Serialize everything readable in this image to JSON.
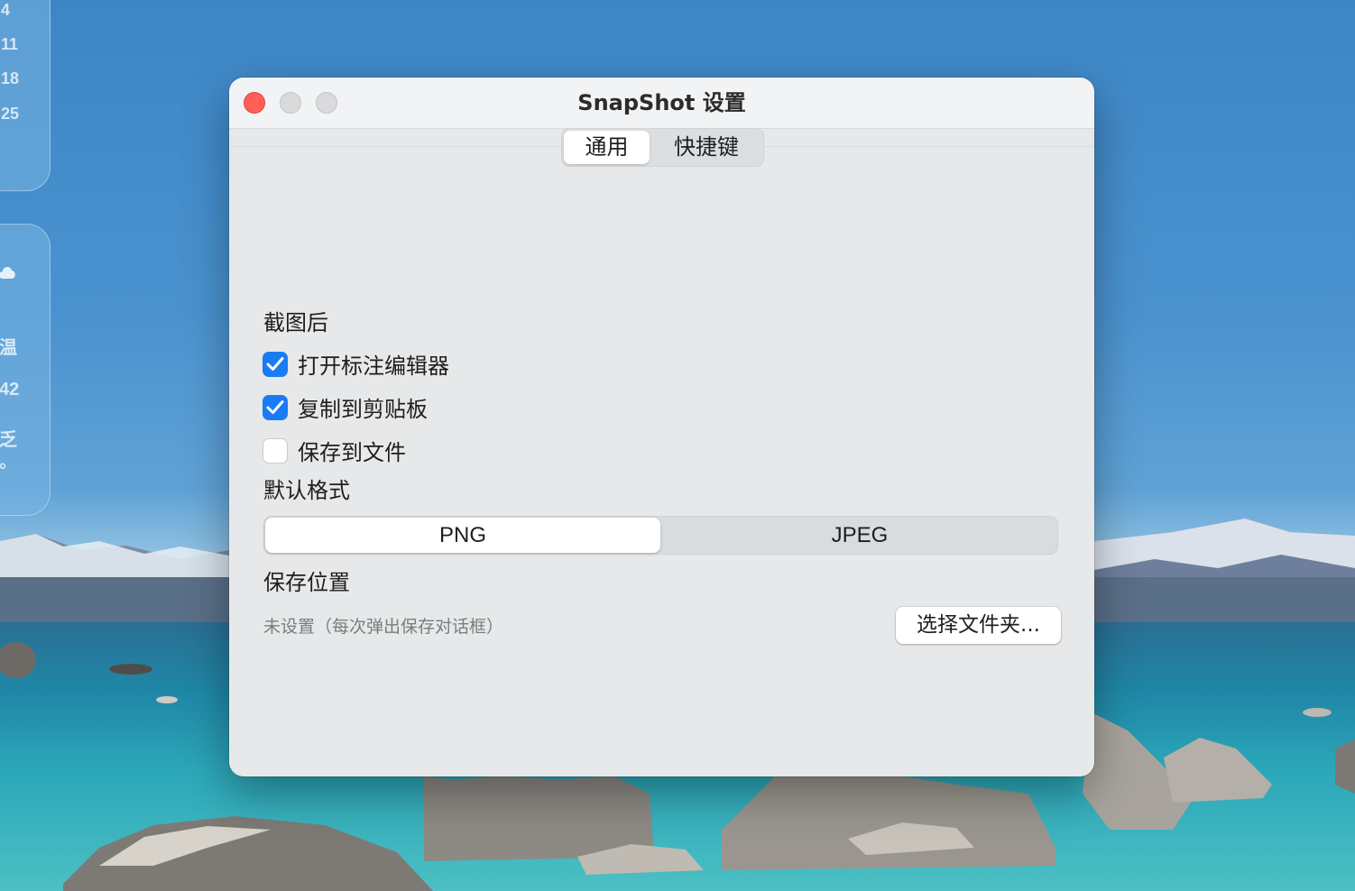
{
  "desktop": {
    "calendar_widget": {
      "dates": [
        "4",
        "11",
        "18",
        "25"
      ]
    },
    "weather_widget": {
      "lines": [
        "温",
        "42",
        "乏",
        "°"
      ]
    }
  },
  "window": {
    "title": "SnapShot 设置",
    "tabs": [
      {
        "label": "通用",
        "selected": true
      },
      {
        "label": "快捷键",
        "selected": false
      }
    ],
    "after_capture": {
      "heading": "截图后",
      "options": [
        {
          "label": "打开标注编辑器",
          "checked": true
        },
        {
          "label": "复制到剪贴板",
          "checked": true
        },
        {
          "label": "保存到文件",
          "checked": false
        }
      ]
    },
    "default_format": {
      "heading": "默认格式",
      "options": [
        "PNG",
        "JPEG"
      ],
      "selected": "PNG"
    },
    "save_location": {
      "heading": "保存位置",
      "path_text": "未设置（每次弹出保存对话框）",
      "choose_button": "选择文件夹..."
    }
  },
  "colors": {
    "accent": "#1a7cf5",
    "close": "#ff5f57"
  }
}
